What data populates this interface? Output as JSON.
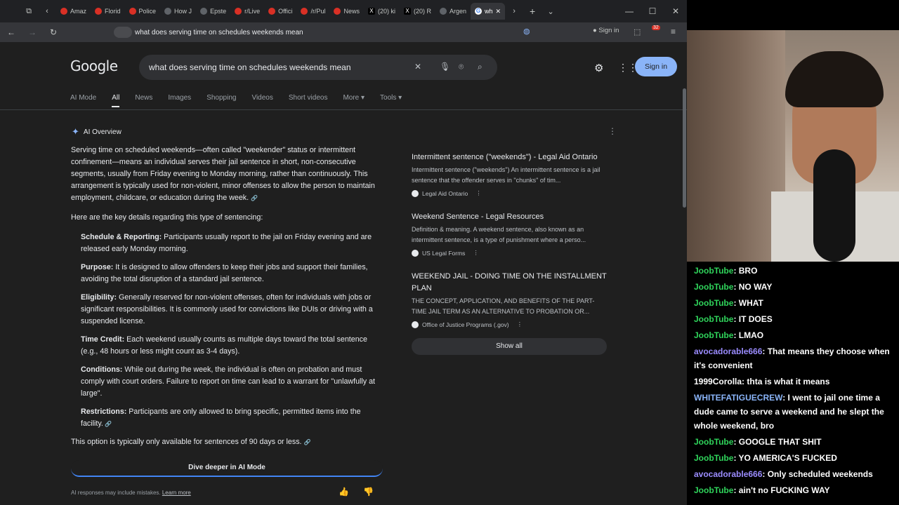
{
  "browser": {
    "tabs": [
      {
        "label": "Amaz",
        "icon": "youtube-icon"
      },
      {
        "label": "Florid",
        "icon": "youtube-icon"
      },
      {
        "label": "Police",
        "icon": "youtube-icon"
      },
      {
        "label": "How J",
        "icon": "tab-icon"
      },
      {
        "label": "Epste",
        "icon": "tab-icon"
      },
      {
        "label": "r/Live",
        "icon": "reddit-icon"
      },
      {
        "label": "Offici",
        "icon": "reddit-icon"
      },
      {
        "label": "/r/Pul",
        "icon": "reddit-icon"
      },
      {
        "label": "News",
        "icon": "reddit-icon"
      },
      {
        "label": "(20) ki",
        "icon": "x-icon"
      },
      {
        "label": "(20) R",
        "icon": "x-icon"
      },
      {
        "label": "Argen",
        "icon": "tab-icon"
      },
      {
        "label": "wh",
        "icon": "google-icon"
      }
    ],
    "address": "what does serving time on schedules weekends mean",
    "sign_in": "Sign in",
    "badge_count": "32"
  },
  "google": {
    "logo": "Google",
    "query": "what does serving time on schedules weekends mean",
    "sign_in": "Sign in",
    "tabs": [
      "AI Mode",
      "All",
      "News",
      "Images",
      "Shopping",
      "Videos",
      "Short videos",
      "More ▾",
      "Tools ▾"
    ],
    "ai_overview": {
      "heading": "AI Overview",
      "intro": "Serving time on scheduled weekends—often called \"weekender\" status or intermittent confinement—means an individual serves their jail sentence in short, non-consecutive segments, usually from Friday evening to Monday morning, rather than continuously. This arrangement is typically used for non-violent, minor offenses to allow the person to maintain employment, childcare, or education during the week.",
      "lead": "Here are the key details regarding this type of sentencing:",
      "items": [
        {
          "term": "Schedule & Reporting:",
          "text": " Participants usually report to the jail on Friday evening and are released early Monday morning."
        },
        {
          "term": "Purpose:",
          "text": " It is designed to allow offenders to keep their jobs and support their families, avoiding the total disruption of a standard jail sentence."
        },
        {
          "term": "Eligibility:",
          "text": " Generally reserved for non-violent offenses, often for individuals with jobs or significant responsibilities. It is commonly used for convictions like DUIs or driving with a suspended license."
        },
        {
          "term": "Time Credit:",
          "text": " Each weekend usually counts as multiple days toward the total sentence (e.g., 48 hours or less might count as 3-4 days)."
        },
        {
          "term": "Conditions:",
          "text": " While out during the week, the individual is often on probation and must comply with court orders. Failure to report on time can lead to a warrant for \"unlawfully at large\"."
        },
        {
          "term": "Restrictions:",
          "text": " Participants are only allowed to bring specific, permitted items into the facility."
        }
      ],
      "closing": "This option is typically only available for sentences of 90 days or less.",
      "dive_deeper": "Dive deeper in AI Mode",
      "disclaimer": "AI responses may include mistakes.",
      "learn_more": "Learn more"
    },
    "sources": [
      {
        "title": "Intermittent sentence (\"weekends\") - Legal Aid Ontario",
        "desc": "Intermittent sentence (\"weekends\") An intermittent sentence is a jail sentence that the offender serves in \"chunks\" of tim...",
        "site": "Legal Aid Ontario"
      },
      {
        "title": "Weekend Sentence - Legal Resources",
        "desc": "Definition & meaning. A weekend sentence, also known as an intermittent sentence, is a type of punishment where a perso...",
        "site": "US Legal Forms"
      },
      {
        "title": "WEEKEND JAIL - DOING TIME ON THE INSTALLMENT PLAN",
        "desc": "THE CONCEPT, APPLICATION, AND BENEFITS OF THE PART-TIME JAIL TERM AS AN ALTERNATIVE TO PROBATION OR...",
        "site": "Office of Justice Programs (.gov)"
      }
    ],
    "show_all": "Show all"
  },
  "chat": {
    "messages": [
      {
        "user": "JoobTube",
        "text": ": BRO",
        "color": "#2fd45b"
      },
      {
        "user": "JoobTube",
        "text": ": NO WAY",
        "color": "#2fd45b"
      },
      {
        "user": "JoobTube",
        "text": ": WHAT",
        "color": "#2fd45b"
      },
      {
        "user": "JoobTube",
        "text": ": IT DOES",
        "color": "#2fd45b"
      },
      {
        "user": "JoobTube",
        "text": ": LMAO",
        "color": "#2fd45b"
      },
      {
        "user": "avocadorable666",
        "text": ": That means they choose when it's convenient",
        "color": "#9b8cff"
      },
      {
        "user": "1999Corolla",
        "text": ": thta is what it means",
        "color": "#ffffff"
      },
      {
        "user": "WHITEFATIGUECREW",
        "text": ": I went to jail one time a dude came to serve a weekend and he slept the whole weekend, bro",
        "color": "#8ab4f8"
      },
      {
        "user": "JoobTube",
        "text": ": GOOGLE THAT SHIT",
        "color": "#2fd45b"
      },
      {
        "user": "JoobTube",
        "text": ": YO AMERICA'S FUCKED",
        "color": "#2fd45b"
      },
      {
        "user": "avocadorable666",
        "text": ": Only scheduled weekends",
        "color": "#9b8cff"
      },
      {
        "user": "JoobTube",
        "text": ": ain't no FUCKING WAY",
        "color": "#2fd45b"
      }
    ]
  }
}
